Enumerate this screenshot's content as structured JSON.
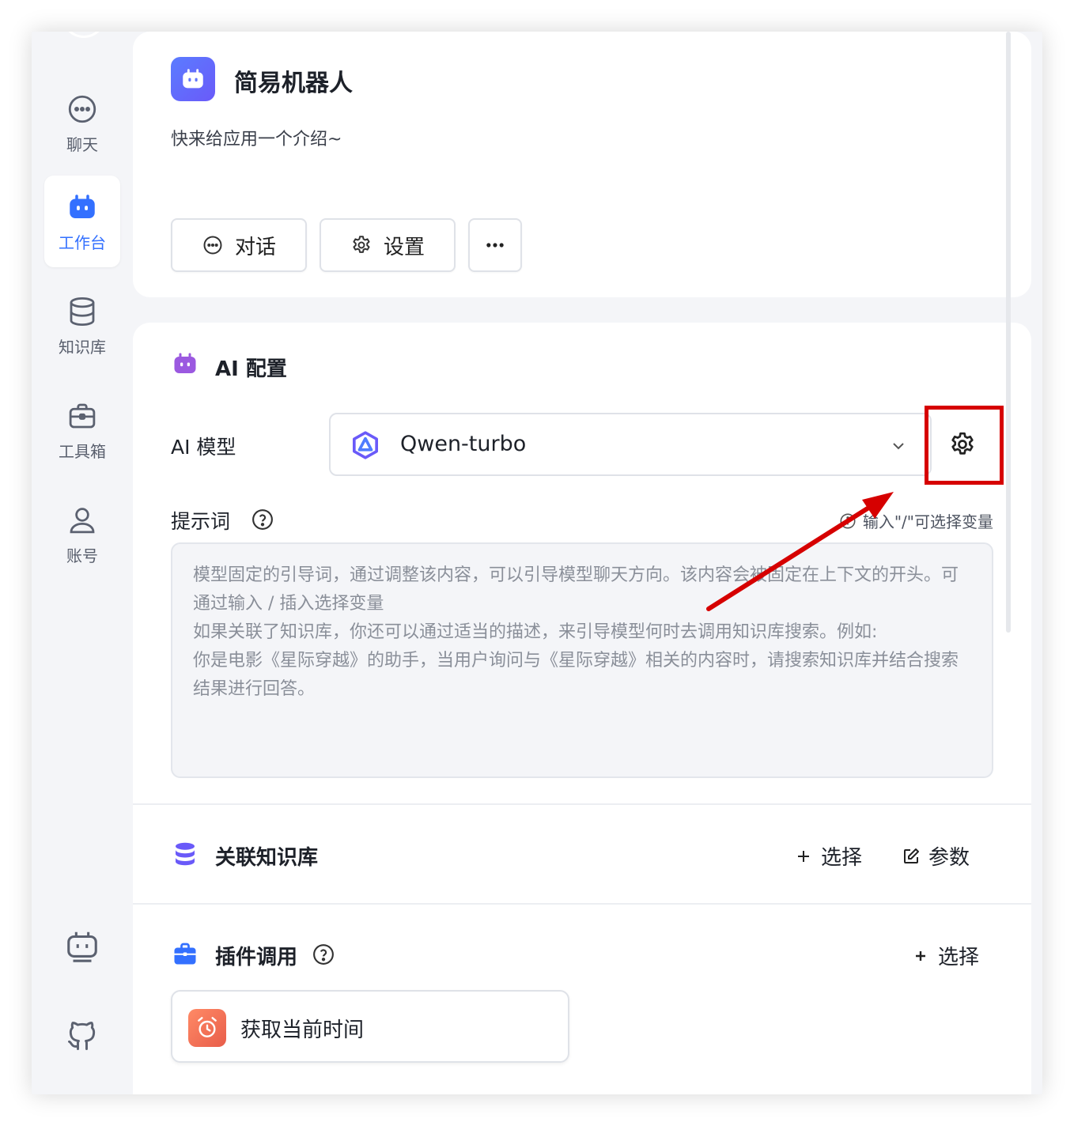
{
  "sidebar": {
    "items": [
      {
        "label": "聊天",
        "icon": "chat-bubble-icon",
        "active": false
      },
      {
        "label": "工作台",
        "icon": "robot-icon",
        "active": true
      },
      {
        "label": "知识库",
        "icon": "database-icon",
        "active": false
      },
      {
        "label": "工具箱",
        "icon": "toolbox-icon",
        "active": false
      },
      {
        "label": "账号",
        "icon": "user-icon",
        "active": false
      }
    ],
    "bottom_icons": [
      "robot-outline-icon",
      "github-icon"
    ]
  },
  "app": {
    "name": "简易机器人",
    "intro": "快来给应用一个介绍~",
    "chat_button": "对话",
    "settings_button": "设置",
    "more_button_icon": "ellipsis-icon"
  },
  "ai_config": {
    "title": "AI 配置",
    "model_label": "AI 模型",
    "model_value": "Qwen-turbo",
    "prompt_label": "提示词",
    "prompt_hint": "输入\"/\"可选择变量",
    "prompt_placeholder_lines": [
      "模型固定的引导词，通过调整该内容，可以引导模型聊天方向。该内容会被固定在上下文的开头。可通过输入 / 插入选择变量",
      "如果关联了知识库，你还可以通过适当的描述，来引导模型何时去调用知识库搜索。例如:",
      "你是电影《星际穿越》的助手，当用户询问与《星际穿越》相关的内容时，请搜索知识库并结合搜索结果进行回答。"
    ]
  },
  "knowledge": {
    "title": "关联知识库",
    "select_label": "选择",
    "params_label": "参数"
  },
  "plugins": {
    "title": "插件调用",
    "select_label": "选择",
    "items": [
      {
        "name": "获取当前时间",
        "icon": "alarm-clock-icon"
      }
    ]
  },
  "colors": {
    "accent": "#3370ff",
    "annotation_red": "#d60000",
    "page_bg": "#f4f5f8"
  }
}
